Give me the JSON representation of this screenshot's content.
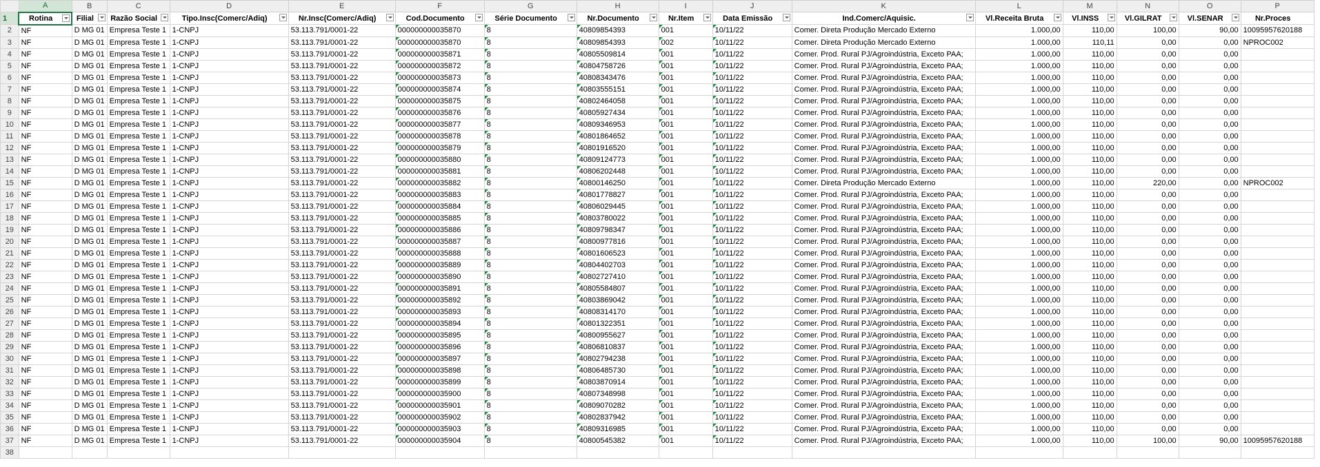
{
  "columns": [
    "A",
    "B",
    "C",
    "D",
    "E",
    "F",
    "G",
    "H",
    "I",
    "J",
    "K",
    "L",
    "M",
    "N",
    "O",
    "P"
  ],
  "headers": [
    "Rotina",
    "Filial",
    "Razão Social",
    "Tipo.Insc(Comerc/Adiq)",
    "Nr.Insc(Comerc/Adiq)",
    "Cod.Documento",
    "Série Documento",
    "Nr.Documento",
    "Nr.Item",
    "Data Emissão",
    "Ind.Comerc/Aquisic.",
    "Vl.Receita Bruta",
    "Vl.INSS",
    "Vl.GILRAT",
    "Vl.SENAR",
    "Nr.Proces"
  ],
  "rows": [
    [
      "NF",
      "D MG 01",
      "Empresa Teste 1",
      "1-CNPJ",
      "53.113.791/0001-22",
      "000000000035870",
      "8",
      "40809854393",
      "001",
      "10/11/22",
      "Comer. Direta Produção Mercado Externo",
      "1.000,00",
      "110,00",
      "100,00",
      "90,00",
      "10095957620188"
    ],
    [
      "NF",
      "D MG 01",
      "Empresa Teste 1",
      "1-CNPJ",
      "53.113.791/0001-22",
      "000000000035870",
      "8",
      "40809854393",
      "002",
      "10/11/22",
      "Comer. Direta Produção Mercado Externo",
      "1.000,00",
      "110,11",
      "0,00",
      "0,00",
      "NPROC002"
    ],
    [
      "NF",
      "D MG 01",
      "Empresa Teste 1",
      "1-CNPJ",
      "53.113.791/0001-22",
      "000000000035871",
      "8",
      "40805509814",
      "001",
      "10/11/22",
      "Comer. Prod. Rural PJ/Agroindústria, Exceto PAA;",
      "1.000,00",
      "110,00",
      "0,00",
      "0,00",
      ""
    ],
    [
      "NF",
      "D MG 01",
      "Empresa Teste 1",
      "1-CNPJ",
      "53.113.791/0001-22",
      "000000000035872",
      "8",
      "40804758726",
      "001",
      "10/11/22",
      "Comer. Prod. Rural PJ/Agroindústria, Exceto PAA;",
      "1.000,00",
      "110,00",
      "0,00",
      "0,00",
      ""
    ],
    [
      "NF",
      "D MG 01",
      "Empresa Teste 1",
      "1-CNPJ",
      "53.113.791/0001-22",
      "000000000035873",
      "8",
      "40808343476",
      "001",
      "10/11/22",
      "Comer. Prod. Rural PJ/Agroindústria, Exceto PAA;",
      "1.000,00",
      "110,00",
      "0,00",
      "0,00",
      ""
    ],
    [
      "NF",
      "D MG 01",
      "Empresa Teste 1",
      "1-CNPJ",
      "53.113.791/0001-22",
      "000000000035874",
      "8",
      "40803555151",
      "001",
      "10/11/22",
      "Comer. Prod. Rural PJ/Agroindústria, Exceto PAA;",
      "1.000,00",
      "110,00",
      "0,00",
      "0,00",
      ""
    ],
    [
      "NF",
      "D MG 01",
      "Empresa Teste 1",
      "1-CNPJ",
      "53.113.791/0001-22",
      "000000000035875",
      "8",
      "40802464058",
      "001",
      "10/11/22",
      "Comer. Prod. Rural PJ/Agroindústria, Exceto PAA;",
      "1.000,00",
      "110,00",
      "0,00",
      "0,00",
      ""
    ],
    [
      "NF",
      "D MG 01",
      "Empresa Teste 1",
      "1-CNPJ",
      "53.113.791/0001-22",
      "000000000035876",
      "8",
      "40805927434",
      "001",
      "10/11/22",
      "Comer. Prod. Rural PJ/Agroindústria, Exceto PAA;",
      "1.000,00",
      "110,00",
      "0,00",
      "0,00",
      ""
    ],
    [
      "NF",
      "D MG 01",
      "Empresa Teste 1",
      "1-CNPJ",
      "53.113.791/0001-22",
      "000000000035877",
      "8",
      "40809346953",
      "001",
      "10/11/22",
      "Comer. Prod. Rural PJ/Agroindústria, Exceto PAA;",
      "1.000,00",
      "110,00",
      "0,00",
      "0,00",
      ""
    ],
    [
      "NF",
      "D MG 01",
      "Empresa Teste 1",
      "1-CNPJ",
      "53.113.791/0001-22",
      "000000000035878",
      "8",
      "40801864652",
      "001",
      "10/11/22",
      "Comer. Prod. Rural PJ/Agroindústria, Exceto PAA;",
      "1.000,00",
      "110,00",
      "0,00",
      "0,00",
      ""
    ],
    [
      "NF",
      "D MG 01",
      "Empresa Teste 1",
      "1-CNPJ",
      "53.113.791/0001-22",
      "000000000035879",
      "8",
      "40801916520",
      "001",
      "10/11/22",
      "Comer. Prod. Rural PJ/Agroindústria, Exceto PAA;",
      "1.000,00",
      "110,00",
      "0,00",
      "0,00",
      ""
    ],
    [
      "NF",
      "D MG 01",
      "Empresa Teste 1",
      "1-CNPJ",
      "53.113.791/0001-22",
      "000000000035880",
      "8",
      "40809124773",
      "001",
      "10/11/22",
      "Comer. Prod. Rural PJ/Agroindústria, Exceto PAA;",
      "1.000,00",
      "110,00",
      "0,00",
      "0,00",
      ""
    ],
    [
      "NF",
      "D MG 01",
      "Empresa Teste 1",
      "1-CNPJ",
      "53.113.791/0001-22",
      "000000000035881",
      "8",
      "40806202448",
      "001",
      "10/11/22",
      "Comer. Prod. Rural PJ/Agroindústria, Exceto PAA;",
      "1.000,00",
      "110,00",
      "0,00",
      "0,00",
      ""
    ],
    [
      "NF",
      "D MG 01",
      "Empresa Teste 1",
      "1-CNPJ",
      "53.113.791/0001-22",
      "000000000035882",
      "8",
      "40800146250",
      "001",
      "10/11/22",
      "Comer. Direta Produção Mercado Externo",
      "1.000,00",
      "110,00",
      "220,00",
      "0,00",
      "NPROC002"
    ],
    [
      "NF",
      "D MG 01",
      "Empresa Teste 1",
      "1-CNPJ",
      "53.113.791/0001-22",
      "000000000035883",
      "8",
      "40801778827",
      "001",
      "10/11/22",
      "Comer. Prod. Rural PJ/Agroindústria, Exceto PAA;",
      "1.000,00",
      "110,00",
      "0,00",
      "0,00",
      ""
    ],
    [
      "NF",
      "D MG 01",
      "Empresa Teste 1",
      "1-CNPJ",
      "53.113.791/0001-22",
      "000000000035884",
      "8",
      "40806029445",
      "001",
      "10/11/22",
      "Comer. Prod. Rural PJ/Agroindústria, Exceto PAA;",
      "1.000,00",
      "110,00",
      "0,00",
      "0,00",
      ""
    ],
    [
      "NF",
      "D MG 01",
      "Empresa Teste 1",
      "1-CNPJ",
      "53.113.791/0001-22",
      "000000000035885",
      "8",
      "40803780022",
      "001",
      "10/11/22",
      "Comer. Prod. Rural PJ/Agroindústria, Exceto PAA;",
      "1.000,00",
      "110,00",
      "0,00",
      "0,00",
      ""
    ],
    [
      "NF",
      "D MG 01",
      "Empresa Teste 1",
      "1-CNPJ",
      "53.113.791/0001-22",
      "000000000035886",
      "8",
      "40809798347",
      "001",
      "10/11/22",
      "Comer. Prod. Rural PJ/Agroindústria, Exceto PAA;",
      "1.000,00",
      "110,00",
      "0,00",
      "0,00",
      ""
    ],
    [
      "NF",
      "D MG 01",
      "Empresa Teste 1",
      "1-CNPJ",
      "53.113.791/0001-22",
      "000000000035887",
      "8",
      "40800977816",
      "001",
      "10/11/22",
      "Comer. Prod. Rural PJ/Agroindústria, Exceto PAA;",
      "1.000,00",
      "110,00",
      "0,00",
      "0,00",
      ""
    ],
    [
      "NF",
      "D MG 01",
      "Empresa Teste 1",
      "1-CNPJ",
      "53.113.791/0001-22",
      "000000000035888",
      "8",
      "40801606523",
      "001",
      "10/11/22",
      "Comer. Prod. Rural PJ/Agroindústria, Exceto PAA;",
      "1.000,00",
      "110,00",
      "0,00",
      "0,00",
      ""
    ],
    [
      "NF",
      "D MG 01",
      "Empresa Teste 1",
      "1-CNPJ",
      "53.113.791/0001-22",
      "000000000035889",
      "8",
      "40804402703",
      "001",
      "10/11/22",
      "Comer. Prod. Rural PJ/Agroindústria, Exceto PAA;",
      "1.000,00",
      "110,00",
      "0,00",
      "0,00",
      ""
    ],
    [
      "NF",
      "D MG 01",
      "Empresa Teste 1",
      "1-CNPJ",
      "53.113.791/0001-22",
      "000000000035890",
      "8",
      "40802727410",
      "001",
      "10/11/22",
      "Comer. Prod. Rural PJ/Agroindústria, Exceto PAA;",
      "1.000,00",
      "110,00",
      "0,00",
      "0,00",
      ""
    ],
    [
      "NF",
      "D MG 01",
      "Empresa Teste 1",
      "1-CNPJ",
      "53.113.791/0001-22",
      "000000000035891",
      "8",
      "40805584807",
      "001",
      "10/11/22",
      "Comer. Prod. Rural PJ/Agroindústria, Exceto PAA;",
      "1.000,00",
      "110,00",
      "0,00",
      "0,00",
      ""
    ],
    [
      "NF",
      "D MG 01",
      "Empresa Teste 1",
      "1-CNPJ",
      "53.113.791/0001-22",
      "000000000035892",
      "8",
      "40803869042",
      "001",
      "10/11/22",
      "Comer. Prod. Rural PJ/Agroindústria, Exceto PAA;",
      "1.000,00",
      "110,00",
      "0,00",
      "0,00",
      ""
    ],
    [
      "NF",
      "D MG 01",
      "Empresa Teste 1",
      "1-CNPJ",
      "53.113.791/0001-22",
      "000000000035893",
      "8",
      "40808314170",
      "001",
      "10/11/22",
      "Comer. Prod. Rural PJ/Agroindústria, Exceto PAA;",
      "1.000,00",
      "110,00",
      "0,00",
      "0,00",
      ""
    ],
    [
      "NF",
      "D MG 01",
      "Empresa Teste 1",
      "1-CNPJ",
      "53.113.791/0001-22",
      "000000000035894",
      "8",
      "40801322351",
      "001",
      "10/11/22",
      "Comer. Prod. Rural PJ/Agroindústria, Exceto PAA;",
      "1.000,00",
      "110,00",
      "0,00",
      "0,00",
      ""
    ],
    [
      "NF",
      "D MG 01",
      "Empresa Teste 1",
      "1-CNPJ",
      "53.113.791/0001-22",
      "000000000035895",
      "8",
      "40800955627",
      "001",
      "10/11/22",
      "Comer. Prod. Rural PJ/Agroindústria, Exceto PAA;",
      "1.000,00",
      "110,00",
      "0,00",
      "0,00",
      ""
    ],
    [
      "NF",
      "D MG 01",
      "Empresa Teste 1",
      "1-CNPJ",
      "53.113.791/0001-22",
      "000000000035896",
      "8",
      "40806810837",
      "001",
      "10/11/22",
      "Comer. Prod. Rural PJ/Agroindústria, Exceto PAA;",
      "1.000,00",
      "110,00",
      "0,00",
      "0,00",
      ""
    ],
    [
      "NF",
      "D MG 01",
      "Empresa Teste 1",
      "1-CNPJ",
      "53.113.791/0001-22",
      "000000000035897",
      "8",
      "40802794238",
      "001",
      "10/11/22",
      "Comer. Prod. Rural PJ/Agroindústria, Exceto PAA;",
      "1.000,00",
      "110,00",
      "0,00",
      "0,00",
      ""
    ],
    [
      "NF",
      "D MG 01",
      "Empresa Teste 1",
      "1-CNPJ",
      "53.113.791/0001-22",
      "000000000035898",
      "8",
      "40806485730",
      "001",
      "10/11/22",
      "Comer. Prod. Rural PJ/Agroindústria, Exceto PAA;",
      "1.000,00",
      "110,00",
      "0,00",
      "0,00",
      ""
    ],
    [
      "NF",
      "D MG 01",
      "Empresa Teste 1",
      "1-CNPJ",
      "53.113.791/0001-22",
      "000000000035899",
      "8",
      "40803870914",
      "001",
      "10/11/22",
      "Comer. Prod. Rural PJ/Agroindústria, Exceto PAA;",
      "1.000,00",
      "110,00",
      "0,00",
      "0,00",
      ""
    ],
    [
      "NF",
      "D MG 01",
      "Empresa Teste 1",
      "1-CNPJ",
      "53.113.791/0001-22",
      "000000000035900",
      "8",
      "40807348998",
      "001",
      "10/11/22",
      "Comer. Prod. Rural PJ/Agroindústria, Exceto PAA;",
      "1.000,00",
      "110,00",
      "0,00",
      "0,00",
      ""
    ],
    [
      "NF",
      "D MG 01",
      "Empresa Teste 1",
      "1-CNPJ",
      "53.113.791/0001-22",
      "000000000035901",
      "8",
      "40809070282",
      "001",
      "10/11/22",
      "Comer. Prod. Rural PJ/Agroindústria, Exceto PAA;",
      "1.000,00",
      "110,00",
      "0,00",
      "0,00",
      ""
    ],
    [
      "NF",
      "D MG 01",
      "Empresa Teste 1",
      "1-CNPJ",
      "53.113.791/0001-22",
      "000000000035902",
      "8",
      "40802837942",
      "001",
      "10/11/22",
      "Comer. Prod. Rural PJ/Agroindústria, Exceto PAA;",
      "1.000,00",
      "110,00",
      "0,00",
      "0,00",
      ""
    ],
    [
      "NF",
      "D MG 01",
      "Empresa Teste 1",
      "1-CNPJ",
      "53.113.791/0001-22",
      "000000000035903",
      "8",
      "40809316985",
      "001",
      "10/11/22",
      "Comer. Prod. Rural PJ/Agroindústria, Exceto PAA;",
      "1.000,00",
      "110,00",
      "0,00",
      "0,00",
      ""
    ],
    [
      "NF",
      "D MG 01",
      "Empresa Teste 1",
      "1-CNPJ",
      "53.113.791/0001-22",
      "000000000035904",
      "8",
      "40800545382",
      "001",
      "10/11/22",
      "Comer. Prod. Rural PJ/Agroindústria, Exceto PAA;",
      "1.000,00",
      "110,00",
      "100,00",
      "90,00",
      "10095957620188"
    ]
  ],
  "trailing_row_numbers": [
    "38"
  ],
  "selected_column": "A",
  "colors": {
    "selection_accent": "#217346",
    "text_number_marker": "#1e8e3e",
    "gridline": "#d4d4d4",
    "header_bg": "#efefef"
  }
}
